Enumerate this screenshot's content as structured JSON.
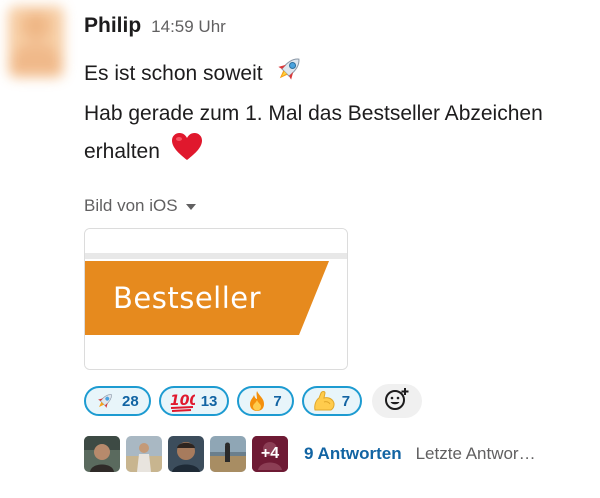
{
  "message": {
    "author": "Philip",
    "time": "14:59 Uhr",
    "line1": "Es ist schon soweit",
    "line2": "Hab gerade zum 1. Mal das Bestseller Abzeichen",
    "line3": "erhalten"
  },
  "file": {
    "label": "Bild von iOS",
    "image_text": "Bestseller",
    "banner_color": "#e68a1e"
  },
  "reactions": [
    {
      "emoji": "rocket-icon",
      "count": "28"
    },
    {
      "emoji": "hundred-points-icon",
      "count": "13"
    },
    {
      "emoji": "fire-icon",
      "count": "7"
    },
    {
      "emoji": "flexed-biceps-icon",
      "count": "7"
    }
  ],
  "thread": {
    "more_count": "+4",
    "replies_label": "9 Antworten",
    "last_reply": "Letzte Antwor…"
  },
  "colors": {
    "reaction_border": "#1d9bd1",
    "reaction_bg": "#e8f5fa",
    "link": "#1264a3",
    "muted": "#616061"
  }
}
